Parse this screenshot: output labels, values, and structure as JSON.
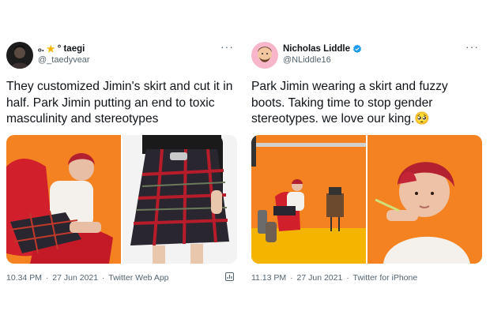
{
  "tweets": [
    {
      "display_name_prefix": "ₒ.",
      "display_name_star": "★",
      "display_name": "° taegi",
      "handle": "@_taedyvear",
      "more_label": "···",
      "text": "They customized Jimin's skirt and cut it in half. Park Jimin putting an end to toxic masculinity and stereotypes",
      "time": "10.34 PM",
      "date": "27 Jun 2021",
      "source": "Twitter Web App",
      "separator": "·"
    },
    {
      "display_name": "Nicholas Liddle",
      "handle": "@NLiddle16",
      "more_label": "···",
      "text": "Park Jimin wearing a skirt and fuzzy boots. Taking time to stop gender stereotypes. we love our king.🥺",
      "time": "11.13 PM",
      "date": "27 Jun 2021",
      "source": "Twitter for iPhone",
      "separator": "·"
    }
  ],
  "colors": {
    "text": "#0f1419",
    "secondary": "#536471",
    "verified": "#1d9bf0",
    "orange_bg": "#f58220",
    "red_chair": "#d11f2b",
    "tartan": "#2a2630"
  },
  "icons": [
    "more-icon",
    "verified-icon",
    "analytics-icon"
  ]
}
